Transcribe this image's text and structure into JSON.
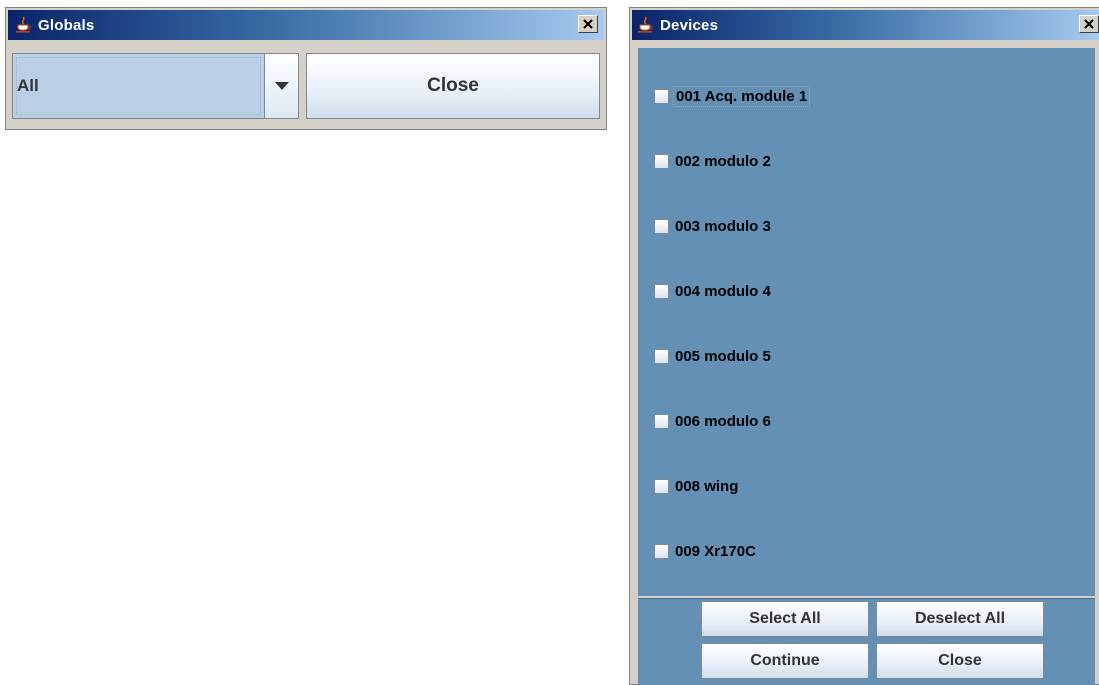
{
  "globals_window": {
    "title": "Globals",
    "combo": {
      "selected": "All"
    },
    "close_label": "Close"
  },
  "devices_window": {
    "title": "Devices",
    "devices": [
      {
        "label": "001 Acq. module 1",
        "checked": false
      },
      {
        "label": "002 modulo 2",
        "checked": false
      },
      {
        "label": "003 modulo 3",
        "checked": false
      },
      {
        "label": "004 modulo 4",
        "checked": false
      },
      {
        "label": "005 modulo 5",
        "checked": false
      },
      {
        "label": "006 modulo 6",
        "checked": false
      },
      {
        "label": "008 wing",
        "checked": false
      },
      {
        "label": "009 Xr170C",
        "checked": false
      }
    ],
    "buttons": {
      "select_all": "Select All",
      "deselect_all": "Deselect All",
      "continue": "Continue",
      "close": "Close"
    }
  },
  "colors": {
    "titlebar_dark": "#0a246a",
    "titlebar_light": "#a6caf0",
    "list_background": "#6390b4",
    "combo_background": "#b8cfe5"
  },
  "icons": {
    "app": "java-cup-icon",
    "close": "close-icon",
    "dropdown": "chevron-down-icon"
  }
}
